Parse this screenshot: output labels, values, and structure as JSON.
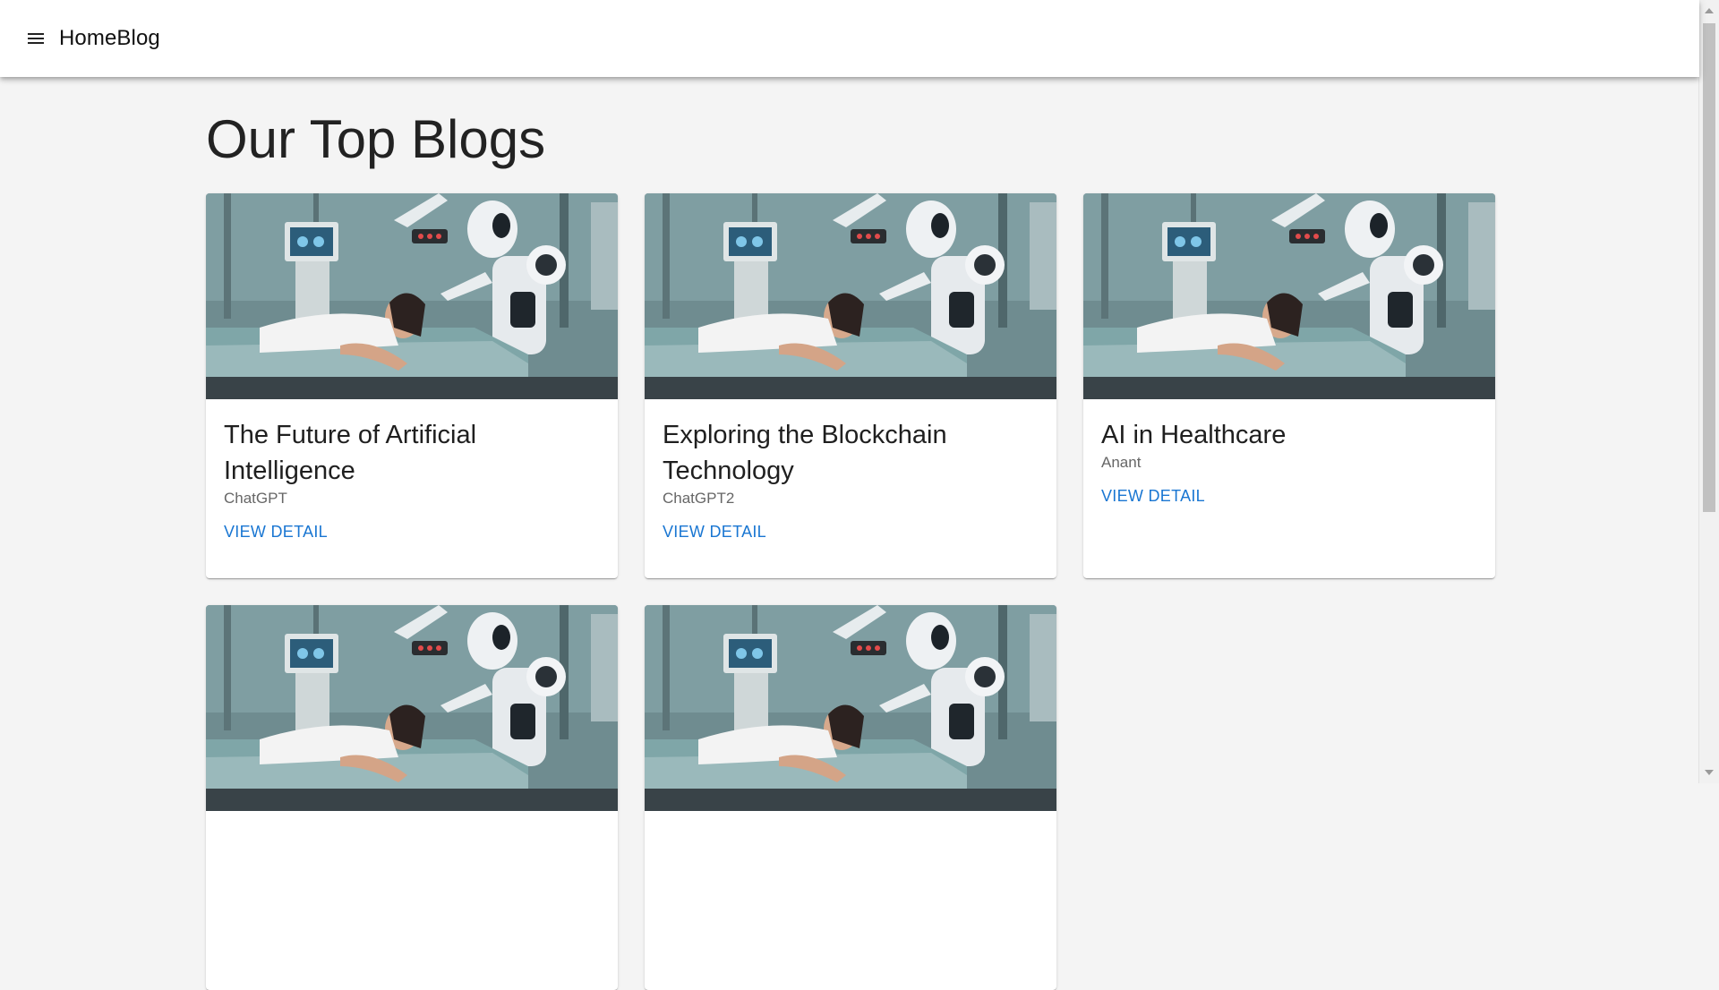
{
  "header": {
    "brand": "HomeBlog",
    "menu_icon": "menu-icon"
  },
  "main": {
    "title": "Our Top Blogs"
  },
  "colors": {
    "accent": "#1976d2",
    "background": "#f4f4f4"
  },
  "blogs": [
    {
      "title": "The Future of Artificial Intelligence",
      "author": "ChatGPT",
      "action": "VIEW DETAIL"
    },
    {
      "title": "Exploring the Blockchain Technology",
      "author": "ChatGPT2",
      "action": "VIEW DETAIL"
    },
    {
      "title": "AI in Healthcare",
      "author": "Anant",
      "action": "VIEW DETAIL"
    },
    {
      "title": "",
      "author": "",
      "action": ""
    },
    {
      "title": "",
      "author": "",
      "action": ""
    }
  ]
}
